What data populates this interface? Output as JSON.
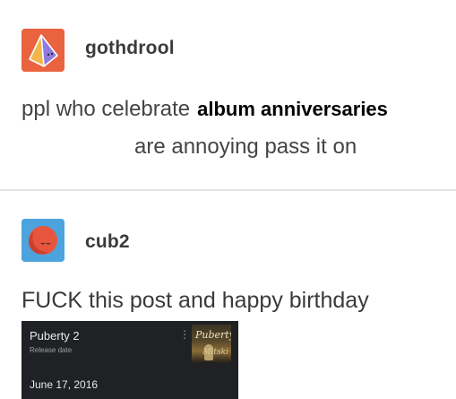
{
  "posts": [
    {
      "username": "gothdrool",
      "avatar_icon": "pyramid-icon",
      "avatar_color": "#e9633f",
      "text_before": "ppl who celebrate",
      "text_highlight": "album anniversaries",
      "text_after": "are annoying pass it on"
    },
    {
      "username": "cub2",
      "avatar_icon": "sleeping-moon-icon",
      "avatar_color": "#4da3dd",
      "text": "FUCK this post and happy birthday",
      "card": {
        "title": "Puberty 2",
        "subtitle": "Release date",
        "date": "June 17, 2016",
        "menu_icon": "more-vert-icon",
        "art_title": "Puberty",
        "art_subtitle": "Mitski"
      }
    }
  ]
}
